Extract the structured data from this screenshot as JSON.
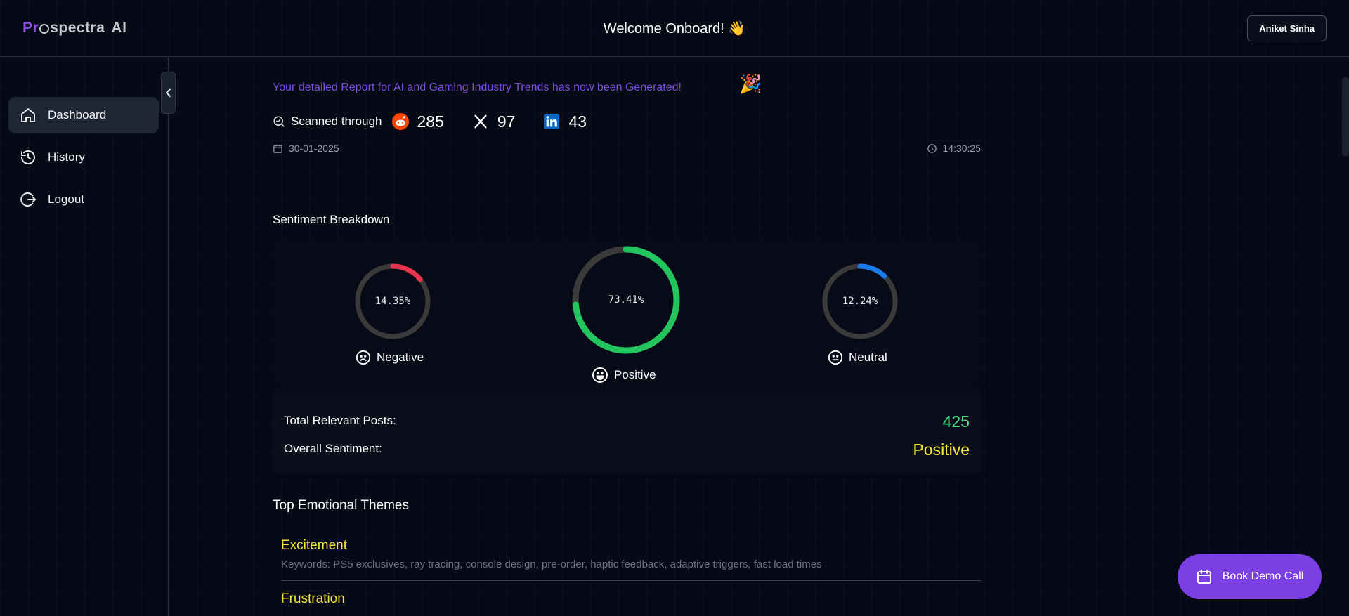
{
  "header": {
    "logo_pr": "Pr",
    "logo_rest": "spectra",
    "logo_ai": "AI",
    "welcome": "Welcome Onboard! 👋",
    "user_name": "Aniket Sinha"
  },
  "sidebar": {
    "items": [
      {
        "label": "Dashboard",
        "icon": "home-icon",
        "active": true
      },
      {
        "label": "History",
        "icon": "history-icon",
        "active": false
      },
      {
        "label": "Logout",
        "icon": "logout-icon",
        "active": false
      }
    ]
  },
  "report": {
    "title": "Your detailed Report for AI and Gaming Industry Trends has now been Generated!",
    "party_emoji": "🎉",
    "scanned_label": "Scanned through",
    "reddit_count": "285",
    "x_count": "97",
    "linkedin_count": "43",
    "date": "30-01-2025",
    "time": "14:30:25"
  },
  "sentiment": {
    "title": "Sentiment Breakdown",
    "negative": {
      "label": "Negative",
      "value_text": "14.35%",
      "fraction": 0.1435,
      "color": "#e8344e"
    },
    "positive": {
      "label": "Positive",
      "value_text": "73.41%",
      "fraction": 0.7341,
      "color": "#22c55e"
    },
    "neutral": {
      "label": "Neutral",
      "value_text": "12.24%",
      "fraction": 0.1224,
      "color": "#1d7bf0"
    },
    "track_color": "#3a3a3a"
  },
  "totals": {
    "posts_label": "Total Relevant Posts:",
    "posts_value": "425",
    "posts_color": "#4ade80",
    "overall_label": "Overall Sentiment:",
    "overall_value": "Positive",
    "overall_color": "#f5e635"
  },
  "themes": {
    "title": "Top Emotional Themes",
    "items": [
      {
        "name": "Excitement",
        "keywords": "Keywords: PS5 exclusives, ray tracing, console design, pre-order, haptic feedback, adaptive triggers, fast load times"
      },
      {
        "name": "Frustration",
        "keywords": ""
      }
    ]
  },
  "demo_button": {
    "label": "Book Demo Call",
    "color": "#7b3fe4"
  }
}
